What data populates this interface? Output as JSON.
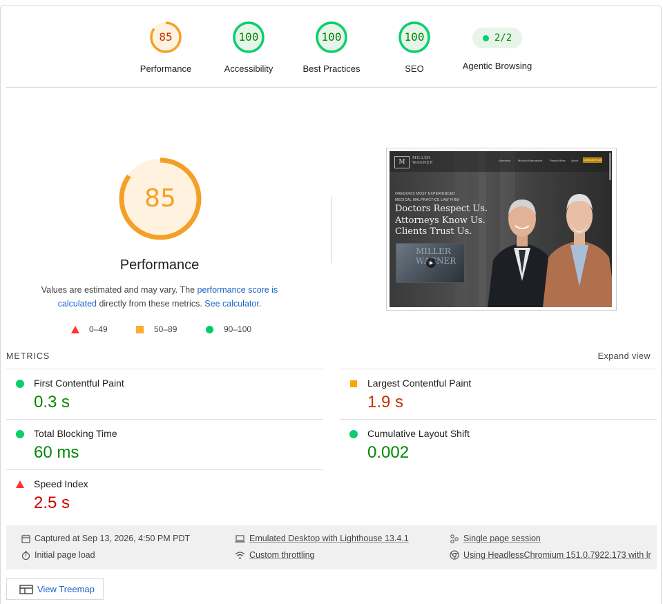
{
  "summary_gauges": [
    {
      "label": "Performance",
      "score": "85",
      "score_value": 85,
      "color": "#f4a028"
    },
    {
      "label": "Accessibility",
      "score": "100",
      "score_value": 100,
      "color": "#0cce6b"
    },
    {
      "label": "Best Practices",
      "score": "100",
      "score_value": 100,
      "color": "#0cce6b"
    },
    {
      "label": "SEO",
      "score": "100",
      "score_value": 100,
      "color": "#0cce6b"
    },
    {
      "label": "Agentic Browsing",
      "score": "2/2"
    }
  ],
  "performance": {
    "score": "85",
    "score_value": 85,
    "title": "Performance",
    "desc_prefix": "Values are estimated and may vary. The ",
    "desc_link1": "performance score is calculated",
    "desc_middle": " directly from these metrics. ",
    "desc_link2": "See calculator",
    "desc_suffix": ".",
    "legend": [
      {
        "shape": "triangle",
        "range": "0–49",
        "color": "#ff3333"
      },
      {
        "shape": "square",
        "range": "50–89",
        "color": "#ffaa33"
      },
      {
        "shape": "circle",
        "range": "90–100",
        "color": "#00cc66"
      }
    ]
  },
  "screenshot": {
    "logo_mark": "M",
    "logo_text_1": "MILLER",
    "logo_text_2": "WAGNER",
    "nav": [
      "Attorneys",
      "Medical Malpractice",
      "Recent Wins",
      "About"
    ],
    "cta": "CONTACT US",
    "kicker_1": "OREGON'S MOST EXPERIENCED",
    "kicker_2": "MEDICAL MALPRACTICE LAW FIRM",
    "headline_1": "Doctors Respect Us.",
    "headline_2": "Attorneys Know Us.",
    "headline_3": "Clients Trust Us.",
    "video_text": "MILLER WAGNER"
  },
  "metrics": {
    "heading": "METRICS",
    "expand_label": "Expand view",
    "items": [
      {
        "name": "First Contentful Paint",
        "value": "0.3 s",
        "rating": "pass"
      },
      {
        "name": "Largest Contentful Paint",
        "value": "1.9 s",
        "rating": "average"
      },
      {
        "name": "Total Blocking Time",
        "value": "60 ms",
        "rating": "pass"
      },
      {
        "name": "Cumulative Layout Shift",
        "value": "0.002",
        "rating": "pass"
      },
      {
        "name": "Speed Index",
        "value": "2.5 s",
        "rating": "fail"
      }
    ]
  },
  "runtime_info": {
    "captured": "Captured at Sep 13, 2026, 4:50 PM PDT",
    "initial_load": "Initial page load",
    "emulated": "Emulated Desktop with Lighthouse 13.4.1",
    "throttling": "Custom throttling",
    "session": "Single page session",
    "browser": "Using HeadlessChromium 151.0.7922.173 with lr"
  },
  "treemap_label": "View Treemap",
  "icons": {
    "calendar": "calendar-icon",
    "stopwatch": "stopwatch-icon",
    "laptop": "laptop-icon",
    "wifi": "wifi-icon",
    "session": "session-icon",
    "chrome": "chrome-icon",
    "treemap": "treemap-icon"
  }
}
